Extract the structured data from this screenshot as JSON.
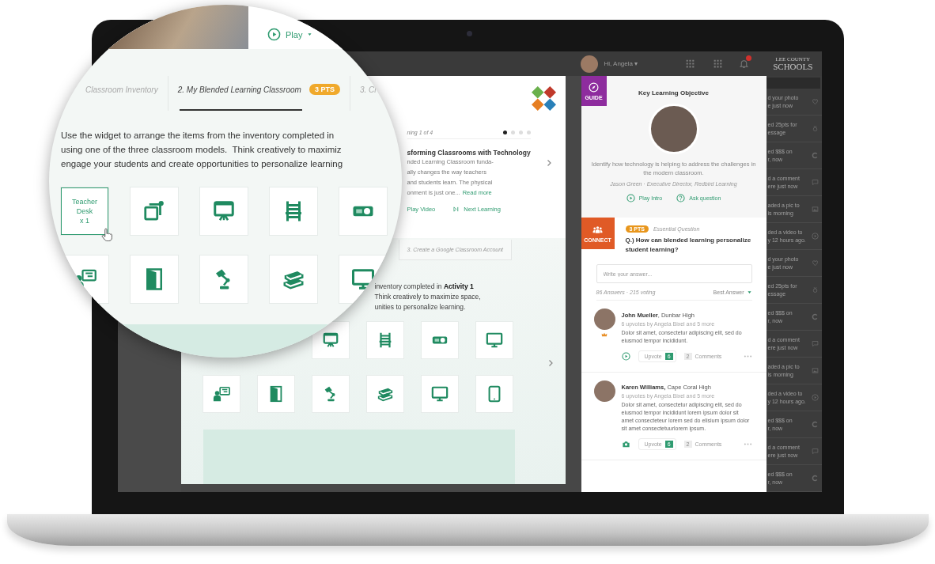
{
  "top_bar": {
    "greeting": "Hi, Angela ▾",
    "notifications": true,
    "logo": [
      "LEE COUNTY",
      "SCHOOLS"
    ]
  },
  "lesson": {
    "counter": "ning 1 of 4",
    "pages": [
      {
        "selected": true
      },
      {
        "selected": false
      },
      {
        "selected": false
      },
      {
        "selected": false
      }
    ],
    "title": "sforming Classrooms with Technology",
    "body_lines": [
      "nded Learning Classroom funda-",
      "ally changes the way teachers",
      "and students learn. The physical",
      "onment is just one..."
    ],
    "read_more": "Read more",
    "actions": [
      {
        "kind": "link",
        "label": "Play Video"
      },
      {
        "kind": "next",
        "label": "Next Learning"
      }
    ]
  },
  "activity": {
    "tabs": [
      {
        "label": "3. Create a Google Classroom Account",
        "selected": false
      }
    ],
    "instructions": [
      "inventory completed in **Activity 1**",
      "Think creatively to maximize space,",
      "unities to personalize learning."
    ],
    "tiles": [
      [
        {
          "kind": "easel"
        },
        {
          "kind": "chair"
        },
        {
          "kind": "projector"
        },
        {
          "kind": "monitor"
        }
      ],
      [
        {
          "kind": "teacher"
        },
        {
          "kind": "door"
        },
        {
          "kind": "lamp"
        },
        {
          "kind": "books"
        },
        {
          "kind": "monitor"
        },
        {
          "kind": "tablet"
        }
      ]
    ]
  },
  "magnifier": {
    "video_action": "Play",
    "tabs": [
      {
        "label": "Classroom Inventory",
        "selected": false
      },
      {
        "label": "2. My Blended Learning Classroom",
        "points": "3 PTS",
        "selected": true
      },
      {
        "label": "3. Cr",
        "selected": false
      }
    ],
    "instructions": [
      "Use the widget to arrange the items from the inventory completed in",
      "using one of the three classroom models.  Think creatively to maximiz",
      "engage your students and create opportunities to personalize learning"
    ],
    "tiles": [
      [
        {
          "kind": "label",
          "label": "Teacher\nDesk\nx 1",
          "selected": true
        },
        {
          "kind": "share",
          "selected": false
        },
        {
          "kind": "easel",
          "selected": false
        },
        {
          "kind": "chair",
          "selected": false
        },
        {
          "kind": "projector",
          "selected": false
        }
      ],
      [
        {
          "kind": "teacher",
          "selected": false
        },
        {
          "kind": "door",
          "selected": false
        },
        {
          "kind": "lamp",
          "selected": false
        },
        {
          "kind": "books",
          "selected": false
        },
        {
          "kind": "monitor",
          "selected": false
        }
      ]
    ]
  },
  "guide": {
    "badge": "GUIDE",
    "title": "Key Learning Objective",
    "objective": "Identify how technology is helping to address the challenges in the modern classroom.",
    "attribution": "Jason Green · Executive Director, Redbird Learning",
    "actions": [
      {
        "kind": "play",
        "label": "Play Intro"
      },
      {
        "kind": "question",
        "label": "Ask question"
      }
    ]
  },
  "connect": {
    "badge": "CONNECT",
    "points": "3 PTS",
    "type": "Essential Question",
    "question": "Q.) How can blended learning personalize student learning?",
    "answer_placeholder": "Write your answer...",
    "stats": "86 Answers · 215 voting",
    "sort": "Best Answer",
    "answers": [
      {
        "author": "**John Mueller**, Dunbar High",
        "upvoters": "6 upvotes by Angela Bixel and 5 more",
        "text": "Dolor sit amet, consectetur adipiscing elit, sed do eiusmod tempor incididunt.",
        "top_answer": true,
        "kind": "play",
        "upvote_label": "Upvote",
        "upvotes": "6",
        "comments": "2",
        "comments_label": "Comments"
      },
      {
        "author": "**Karen Williams,** Cape Coral High",
        "upvoters": "6 upvotes by Angela Bixel and 5 more",
        "text": "Dolor sit amet, consectetur adipiscing elit, sed do eiusmod tempor incididunt lorem ipsum dolor sit amet consecteteur lorem sed do elisium ipsum dolor sit amet consectetuurlorem ipsum.",
        "top_answer": false,
        "kind": "camera",
        "upvote_label": "Upvote",
        "upvotes": "6",
        "comments": "2",
        "comments_label": "Comments"
      }
    ]
  },
  "feed": [
    {
      "lines": [
        "d your photo",
        "e just now"
      ],
      "kind": "heart"
    },
    {
      "lines": [
        "ed 25pts for",
        "essage"
      ],
      "kind": "medal"
    },
    {
      "lines": [
        "ed $$$ on",
        "r, now"
      ],
      "kind": "coin"
    },
    {
      "lines": [
        "d a comment",
        "ere just now"
      ],
      "kind": "comment"
    },
    {
      "lines": [
        "aded a pic to",
        "is morning"
      ],
      "kind": "image"
    },
    {
      "lines": [
        "ded a video to",
        "y 12 hours ago."
      ],
      "kind": "play"
    },
    {
      "lines": [
        "d your photo",
        "e just now"
      ],
      "kind": "heart"
    },
    {
      "lines": [
        "ed 25pts for",
        "essage"
      ],
      "kind": "medal"
    },
    {
      "lines": [
        "ed $$$ on",
        "r, now"
      ],
      "kind": "coin"
    },
    {
      "lines": [
        "d a comment",
        "ere just now"
      ],
      "kind": "comment"
    },
    {
      "lines": [
        "aded a pic to",
        "is morning"
      ],
      "kind": "image"
    },
    {
      "lines": [
        "ded a video to",
        "y 12 hours ago."
      ],
      "kind": "play"
    },
    {
      "lines": [
        "ed $$$ on",
        "r, now"
      ],
      "kind": "coin"
    },
    {
      "lines": [
        "d a comment",
        "ere just now"
      ],
      "kind": "comment"
    },
    {
      "lines": [
        "ed $$$ on",
        "r, now"
      ],
      "kind": "coin"
    }
  ]
}
